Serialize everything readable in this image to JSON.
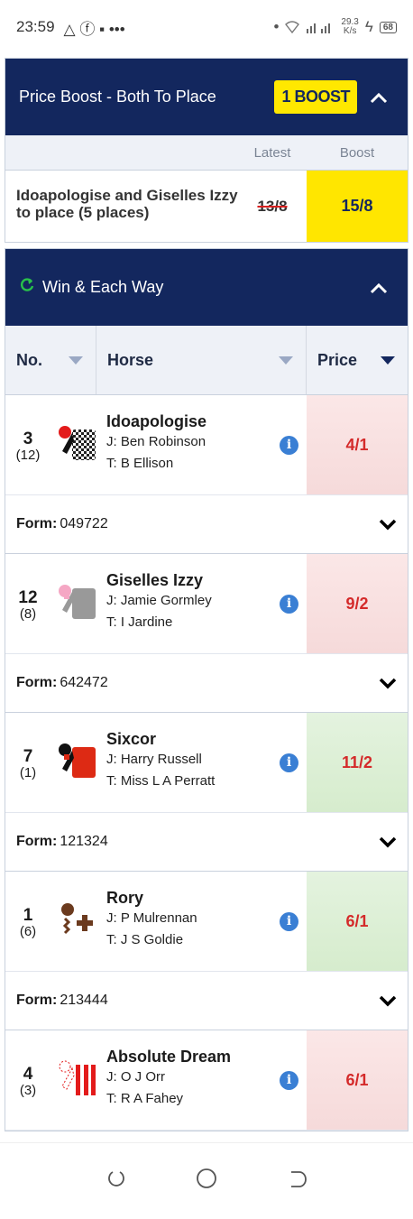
{
  "status_bar": {
    "time": "23:59",
    "left_icons": "△ ⓕ ▪ •••",
    "net_speed_value": "29.3",
    "net_speed_unit": "K/s",
    "battery": "68"
  },
  "boost": {
    "title": "Price Boost - Both To Place",
    "badge": "1 BOOST",
    "col_latest": "Latest",
    "col_boost": "Boost",
    "selection": "Idoapologise and Giselles Izzy to place (5 places)",
    "old_price": "13/8",
    "new_price": "15/8"
  },
  "market": {
    "title": "Win & Each Way",
    "headers": {
      "no": "No.",
      "horse": "Horse",
      "price": "Price"
    },
    "form_label": "Form:",
    "runners": [
      {
        "number": "3",
        "draw": "(12)",
        "name": "Idoapologise",
        "jockey": "J: Ben Robinson",
        "trainer": "T: B Ellison",
        "price": "4/1",
        "form": "049722",
        "trend": "drift"
      },
      {
        "number": "12",
        "draw": "(8)",
        "name": "Giselles Izzy",
        "jockey": "J: Jamie Gormley",
        "trainer": "T: I Jardine",
        "price": "9/2",
        "form": "642472",
        "trend": "drift"
      },
      {
        "number": "7",
        "draw": "(1)",
        "name": "Sixcor",
        "jockey": "J: Harry Russell",
        "trainer": "T: Miss L A Perratt",
        "price": "11/2",
        "form": "121324",
        "trend": "steam"
      },
      {
        "number": "1",
        "draw": "(6)",
        "name": "Rory",
        "jockey": "J: P Mulrennan",
        "trainer": "T: J S Goldie",
        "price": "6/1",
        "form": "213444",
        "trend": "steam"
      },
      {
        "number": "4",
        "draw": "(3)",
        "name": "Absolute Dream",
        "jockey": "J: O J Orr",
        "trainer": "T: R A Fahey",
        "price": "6/1",
        "trend": "drift"
      }
    ]
  },
  "colors": {
    "navy": "#13275e",
    "boost_yellow": "#ffe600",
    "price_red": "#d42a2a",
    "drift_bg": "#fbe7e7",
    "steam_bg": "#e4f3df"
  },
  "icons": [
    "refresh-icon",
    "chevron-up-icon",
    "info-icon",
    "chevron-down-icon",
    "sort-triangle-icon"
  ]
}
